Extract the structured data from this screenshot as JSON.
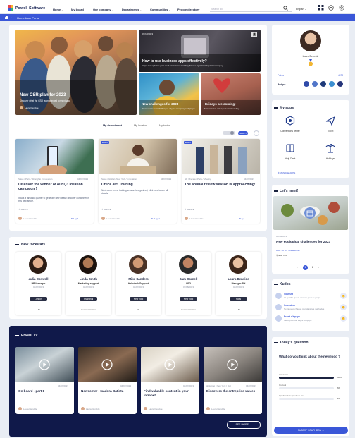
{
  "app": {
    "brand": "Powell Software"
  },
  "nav": [
    "Home",
    "My board",
    "Our company",
    "Departments",
    "Communities",
    "People directory"
  ],
  "nav_dropdowns": [
    true,
    false,
    true,
    true,
    true,
    false
  ],
  "search": {
    "placeholder": "Search all"
  },
  "lang": {
    "value": "English"
  },
  "breadcrumb": {
    "text": "Home User Portal"
  },
  "hero": {
    "main": {
      "title": "New CSR plan for 2023",
      "desc": "Discover what the CSR team planned for next year",
      "author": "Laura Denvide"
    },
    "tile1": {
      "date": "07/12/2023",
      "title": "How to use business apps effectively?",
      "desc": "Apps can optimize your work processes, and they have a significant impact on employ..."
    },
    "tile2": {
      "title": "New challenges for 2023",
      "desc": "Discover the new challenges of your company and prepa..."
    },
    "tile3": {
      "title": "Holidays are coming!",
      "desc": "Remember to enter your vacation day..."
    }
  },
  "tabs": [
    "My department",
    "My location",
    "My topics"
  ],
  "filter": {
    "label": "Sales"
  },
  "news": [
    {
      "tags": "Sales / Paris / Shanghai / Innovation",
      "date": "04/07/2023",
      "title": "Discover the winner of our Q3 ideation campaign !",
      "desc": "It was a fantastic quarter to generate new ideas ! discover our winner in this new article.",
      "share": "SHARE",
      "author": "Laura Denvide",
      "badge": ""
    },
    {
      "tags": "Sales / Global / New York / Innovation",
      "date": "04/07/2023",
      "title": "Office 365 Training",
      "desc": "Next week a new training session is organized, click here to see all details.",
      "share": "SHARE",
      "author": "Laura Denvide",
      "badge": "Event"
    },
    {
      "tags": "HR / Kerala / Paris / Meeting",
      "date": "04/07/2023",
      "title": "The annual review season is approaching!",
      "desc": "",
      "share": "SHARE",
      "author": "Laura Denvide",
      "badge": "Event"
    }
  ],
  "rockstars": {
    "title": "New rockstars",
    "people": [
      {
        "name": "Julia Conwell",
        "role": "HR Manager",
        "date": "04/07/2023",
        "city": "London",
        "dept": "HR"
      },
      {
        "name": "Linda Smith",
        "role": "Marketing support",
        "date": "04/07/2023",
        "city": "Shanghai",
        "dept": "Communication"
      },
      {
        "name": "Mike Sanders",
        "role": "Helpdesk Support",
        "date": "04/07/2023",
        "city": "New York",
        "dept": "IT"
      },
      {
        "name": "Sam Cornell",
        "role": "CEO",
        "date": "07/08/2023",
        "city": "New York",
        "dept": "Communication"
      },
      {
        "name": "Laura Denvide",
        "role": "Manager RH",
        "date": "04/07/2023",
        "city": "Paris",
        "dept": "HR"
      }
    ]
  },
  "tv": {
    "title": "Powell TV",
    "videos": [
      {
        "date": "04/07/2023",
        "tags": "",
        "title": "On board - part 1",
        "author": "Laura Denvide"
      },
      {
        "date": "04/07/2023",
        "tags": "",
        "title": "Newcomer - Isadora Batista",
        "author": "Laura Denvide"
      },
      {
        "date": "04/07/2023",
        "tags": "",
        "title": "Find valuable content in your intranet",
        "author": "Laura Denvide"
      },
      {
        "date": "04/07/2023",
        "tags": "Marketing / New York / Doc",
        "title": "Discovers the entreprise values",
        "author": "Laura Denvide"
      }
    ],
    "see_more": "SEE MORE"
  },
  "profile": {
    "name": "Laura Denvide",
    "points_label": "Points",
    "points_value": "4070",
    "badges_label": "Badges"
  },
  "apps": {
    "title": "My apps",
    "items": [
      {
        "label": "Conventions center",
        "icon": "hexagon-icon"
      },
      {
        "label": "Travel",
        "icon": "plane-icon"
      },
      {
        "label": "Help Desk",
        "icon": "book-icon"
      },
      {
        "label": "Holidays",
        "icon": "palm-icon"
      }
    ],
    "manage": "MANAGE APPS"
  },
  "meet": {
    "title": "Let's meet!",
    "date": "06/10/2023",
    "event_title": "New ecological challenges for 2023",
    "add": "ADD TO MY CALENDAR",
    "place": "New York",
    "pages": [
      "1",
      "2"
    ]
  },
  "kudos": {
    "title": "Kudos",
    "items": [
      {
        "name": "Sourisnt",
        "text": "La qualité que tu donnes pour ce projet"
      },
      {
        "name": "Innovateur",
        "text": "Tu innoves chaque jour dans tes méthodes"
      },
      {
        "name": "Esprit d'équipe",
        "text": "Merci pour ton esprit d'équipe"
      }
    ]
  },
  "question": {
    "title": "Today's question",
    "q": "What do you think about the new logo ?",
    "answers": [
      {
        "label": "Awesome",
        "pct": 100
      },
      {
        "label": "It's cool",
        "pct": 0
      },
      {
        "label": "I prefered the previous one",
        "pct": 0
      }
    ],
    "submit": "SUBMIT YOUR IDEA"
  },
  "colors": {
    "accent": "#3a57d8",
    "navy": "#10194a",
    "dark": "#1b2340"
  }
}
